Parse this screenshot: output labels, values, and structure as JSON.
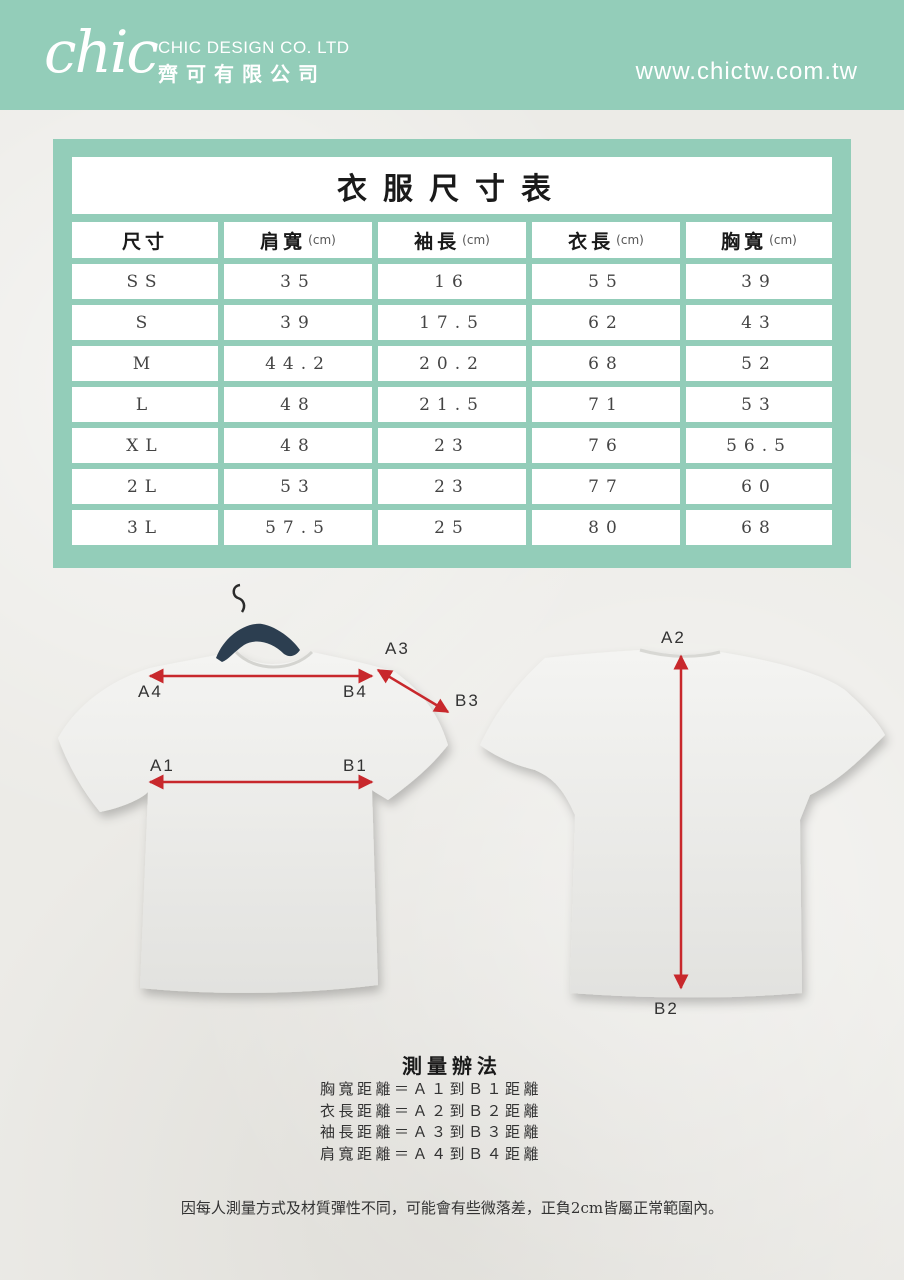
{
  "header": {
    "logo": "chic",
    "company_en": "CHIC DESIGN CO. LTD",
    "company_zh": "齊可有限公司",
    "website": "www.chictw.com.tw"
  },
  "table": {
    "title": "衣服尺寸表",
    "columns": [
      {
        "label": "尺寸",
        "unit": ""
      },
      {
        "label": "肩寬",
        "unit": "(cm)"
      },
      {
        "label": "袖長",
        "unit": "(cm)"
      },
      {
        "label": "衣長",
        "unit": "(cm)"
      },
      {
        "label": "胸寬",
        "unit": "(cm)"
      }
    ],
    "rows": [
      [
        "SS",
        "35",
        "16",
        "55",
        "39"
      ],
      [
        "S",
        "39",
        "17.5",
        "62",
        "43"
      ],
      [
        "M",
        "44.2",
        "20.2",
        "68",
        "52"
      ],
      [
        "L",
        "48",
        "21.5",
        "71",
        "53"
      ],
      [
        "XL",
        "48",
        "23",
        "76",
        "56.5"
      ],
      [
        "2L",
        "53",
        "23",
        "77",
        "60"
      ],
      [
        "3L",
        "57.5",
        "25",
        "80",
        "68"
      ]
    ]
  },
  "diagram": {
    "labels": {
      "a1": "A1",
      "b1": "B1",
      "a2": "A2",
      "b2": "B2",
      "a3": "A3",
      "b3": "B3",
      "a4": "A4",
      "b4": "B4"
    },
    "line_color": "#c8282c"
  },
  "instructions": {
    "title": "測量辦法",
    "lines": [
      "胸寬距離＝Ａ１到Ｂ１距離",
      "衣長距離＝Ａ２到Ｂ２距離",
      "袖長距離＝Ａ３到Ｂ３距離",
      "肩寬距離＝Ａ４到Ｂ４距離"
    ]
  },
  "footnote": "因每人測量方式及材質彈性不同，可能會有些微落差，正負2cm皆屬正常範圍內。",
  "colors": {
    "brand": "#93cdb9",
    "background": "#ecebe7",
    "hanger": "#2c3e50"
  }
}
